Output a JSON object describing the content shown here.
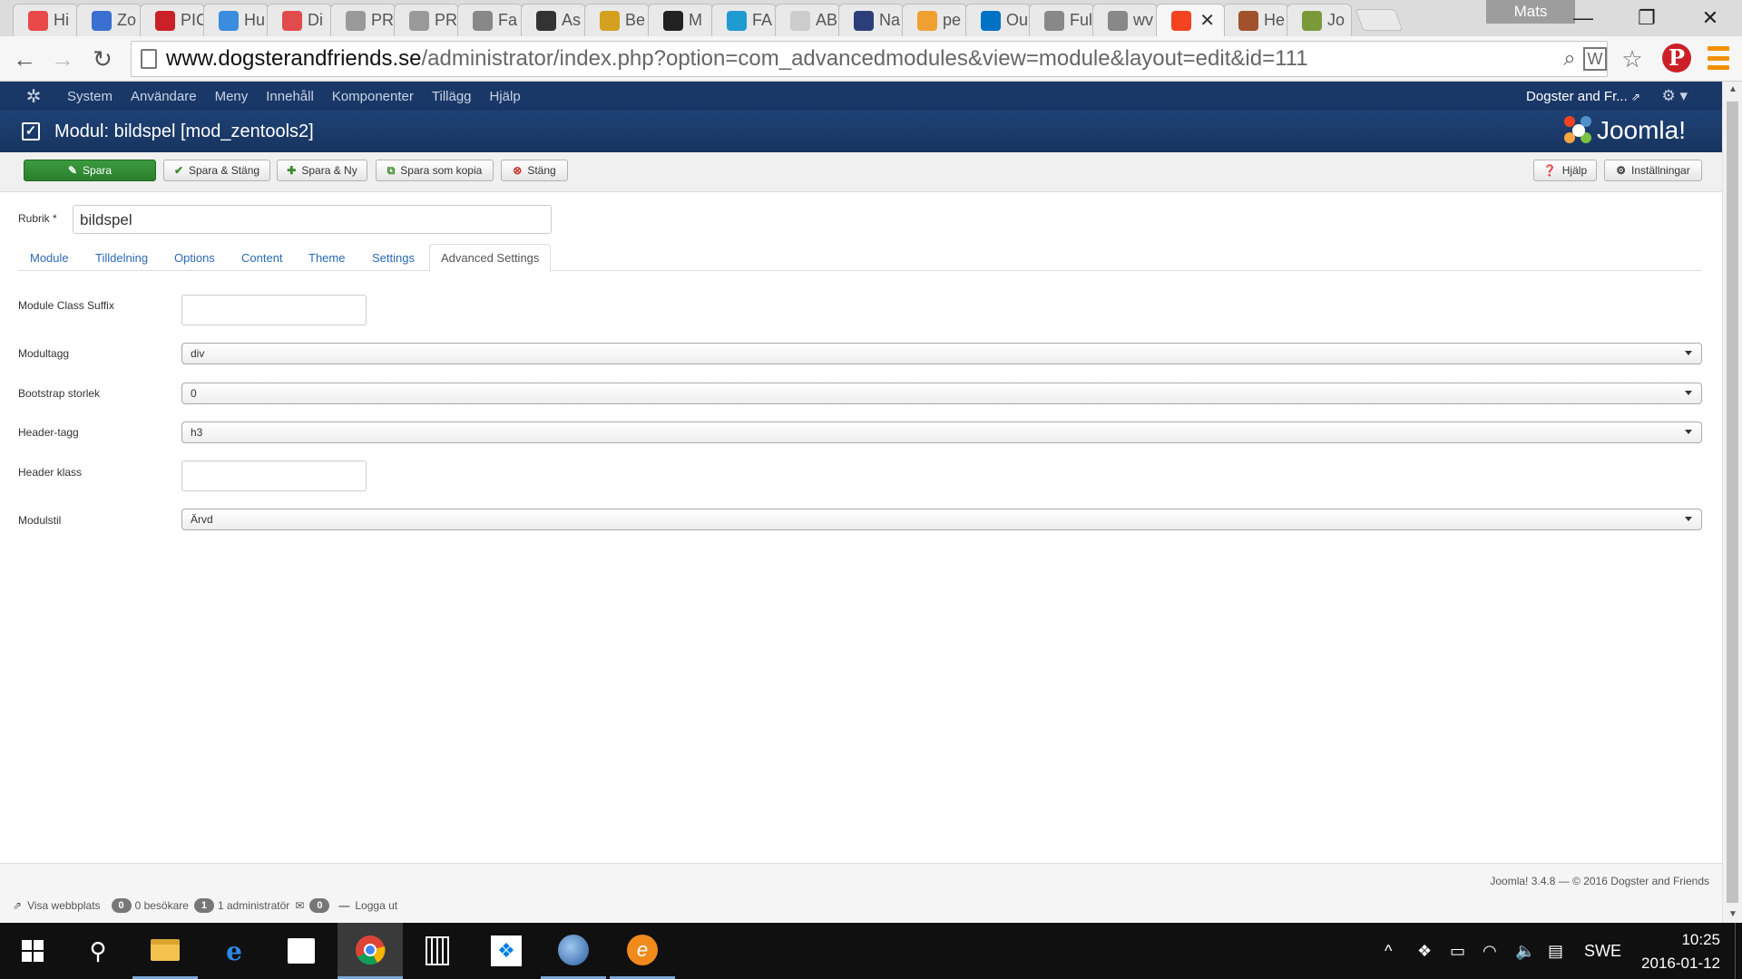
{
  "browser": {
    "tabs": [
      {
        "label": "Hi",
        "icon": "puzzle-icon",
        "color": "#e84a4a"
      },
      {
        "label": "Zo",
        "icon": "zoho-icon",
        "color": "#3b6fd1"
      },
      {
        "label": "PIC",
        "icon": "pinterest-icon",
        "color": "#cb2027"
      },
      {
        "label": "Hu",
        "icon": "hu-icon",
        "color": "#3a8dde"
      },
      {
        "label": "Di",
        "icon": "heart-icon",
        "color": "#e24b4b"
      },
      {
        "label": "PR",
        "icon": "crown-icon",
        "color": "#999999"
      },
      {
        "label": "PR",
        "icon": "crown-icon",
        "color": "#999999"
      },
      {
        "label": "Fa",
        "icon": "page-icon",
        "color": "#888888"
      },
      {
        "label": "As",
        "icon": "dm-icon",
        "color": "#333333"
      },
      {
        "label": "Be",
        "icon": "be-icon",
        "color": "#d4a020"
      },
      {
        "label": "M",
        "icon": "terminal-icon",
        "color": "#222222"
      },
      {
        "label": "FA",
        "icon": "fa-icon",
        "color": "#1f9bd1"
      },
      {
        "label": "AB",
        "icon": "blank-icon",
        "color": "#cccccc"
      },
      {
        "label": "Na",
        "icon": "n-icon",
        "color": "#2c3e7a"
      },
      {
        "label": "pe",
        "icon": "chart-icon",
        "color": "#f0a030"
      },
      {
        "label": "Ou",
        "icon": "outlook-icon",
        "color": "#0072c6"
      },
      {
        "label": "Ful",
        "icon": "page-icon",
        "color": "#888888"
      },
      {
        "label": "wv",
        "icon": "page-icon",
        "color": "#888888"
      },
      {
        "label": "",
        "icon": "joomla-icon",
        "color": "#f44321",
        "active": true
      },
      {
        "label": "He",
        "icon": "dog-icon",
        "color": "#a0522d"
      },
      {
        "label": "Jo",
        "icon": "jo-icon",
        "color": "#7a9a3a"
      }
    ],
    "active_tab_close": "✕",
    "user_badge": "Mats",
    "url_host": "www.dogsterandfriends.se",
    "url_path": "/administrator/index.php?option=com_advancedmodules&view=module&layout=edit&id=111"
  },
  "joomla": {
    "nav": {
      "items": [
        "System",
        "Användare",
        "Meny",
        "Innehåll",
        "Komponenter",
        "Tillägg",
        "Hjälp"
      ],
      "site_link": "Dogster and Fr..."
    },
    "header": {
      "title": "Modul: bildspel [mod_zentools2]",
      "brand": "Joomla!"
    },
    "toolbar": {
      "save": "Spara",
      "save_close": "Spara & Stäng",
      "save_new": "Spara & Ny",
      "save_copy": "Spara som kopia",
      "close": "Stäng",
      "help": "Hjälp",
      "settings": "Inställningar"
    },
    "form": {
      "title_label": "Rubrik *",
      "title_value": "bildspel",
      "tabs": [
        "Module",
        "Tilldelning",
        "Options",
        "Content",
        "Theme",
        "Settings",
        "Advanced Settings"
      ],
      "active_tab": "Advanced Settings",
      "fields": {
        "class_suffix": {
          "label": "Module Class Suffix",
          "value": ""
        },
        "module_tag": {
          "label": "Modultagg",
          "value": "div"
        },
        "bootstrap_size": {
          "label": "Bootstrap storlek",
          "value": "0"
        },
        "header_tag": {
          "label": "Header-tagg",
          "value": "h3"
        },
        "header_class": {
          "label": "Header klass",
          "value": ""
        },
        "module_style": {
          "label": "Modulstil",
          "value": "Ärvd"
        }
      }
    },
    "footer": {
      "view_site": "Visa webbplats",
      "visitors_count": "0",
      "visitors_label": "0 besökare",
      "admins_count": "1",
      "admins_label": "1 administratör",
      "messages_count": "0",
      "logout": "Logga ut",
      "version": "Joomla! 3.4.8  —  © 2016 Dogster and Friends"
    }
  },
  "taskbar": {
    "language": "SWE",
    "time": "10:25",
    "date": "2016-01-12"
  },
  "colors": {
    "joomla_nav": "#1a3867",
    "joomla_header": "#1b3d6f",
    "save_green": "#2f8a32",
    "link_blue": "#2a69b8",
    "taskbar": "#101010"
  }
}
